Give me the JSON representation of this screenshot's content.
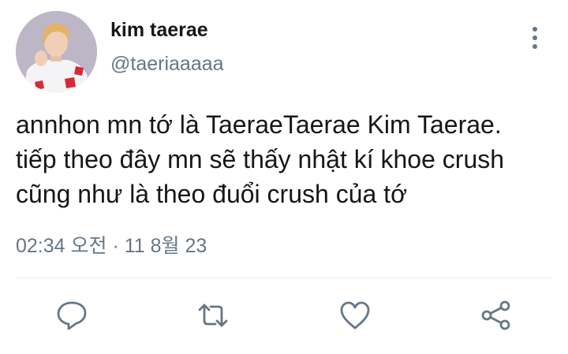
{
  "user": {
    "display_name": "kim taerae",
    "handle": "@taeriaaaaa"
  },
  "tweet": {
    "lines": [
      "annhon mn tớ là TaeraeTaerae Kim Taerae.",
      "tiếp theo đây mn sẽ thấy nhật kí khoe crush",
      "cũng như là theo đuổi crush của tớ"
    ],
    "timestamp": "02:34 오전 · 11 8월 23"
  },
  "icons": {
    "more": "more-vertical-icon",
    "reply": "reply-icon",
    "retweet": "retweet-icon",
    "like": "heart-icon",
    "share": "share-icon"
  },
  "colors": {
    "text": "#14171a",
    "secondary": "#657786",
    "divider": "#e6ecf0",
    "icon": "#657786"
  }
}
